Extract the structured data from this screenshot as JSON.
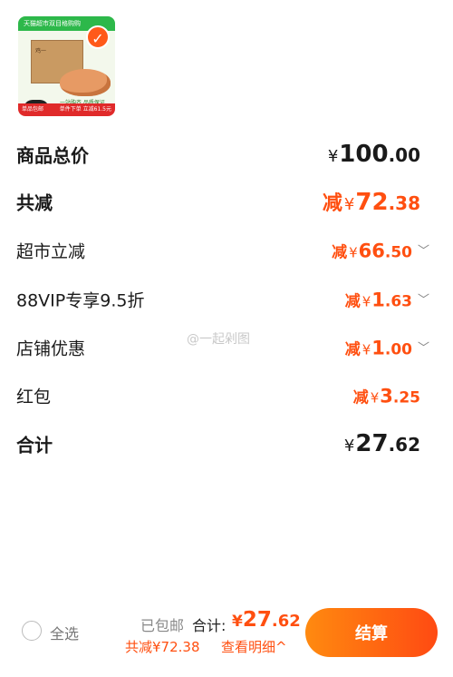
{
  "product": {
    "banner_text": "天猫超市双目格购购",
    "box_label": "鸡一",
    "subtitle": "一站购齐 品质保证",
    "strip_left": "单品包邮",
    "strip_right": "单件下单 立减61.5元",
    "selected": true
  },
  "rows": {
    "total_goods": {
      "label": "商品总价",
      "yen": "¥",
      "int": "100",
      "dec": ".00"
    },
    "total_discount": {
      "label": "共减",
      "prefix": "减",
      "yen": "¥",
      "int": "72",
      "dec": ".38"
    },
    "supermarket": {
      "label": "超市立减",
      "prefix": "减",
      "yen": "¥",
      "int": "66",
      "dec": ".50"
    },
    "vip": {
      "label": "88VIP专享9.5折",
      "prefix": "减",
      "yen": "¥",
      "int": "1",
      "dec": ".63"
    },
    "store": {
      "label": "店铺优惠",
      "prefix": "减",
      "yen": "¥",
      "int": "1",
      "dec": ".00"
    },
    "redpacket": {
      "label": "红包",
      "prefix": "减",
      "yen": "¥",
      "int": "3",
      "dec": ".25"
    },
    "sum": {
      "label": "合计",
      "yen": "¥",
      "int": "27",
      "dec": ".62"
    }
  },
  "watermark": "@一起剁图",
  "bottom": {
    "select_all": "全选",
    "shipping": "已包邮",
    "total_label": "合计:",
    "total_yen": "¥",
    "total_int": "27",
    "total_dec": ".62",
    "savings": "共减¥72.38",
    "detail": "查看明细^",
    "checkout": "结算"
  },
  "colors": {
    "accent": "#ff4f10",
    "checkout_start": "#ff8a10",
    "checkout_end": "#ff4a12"
  }
}
